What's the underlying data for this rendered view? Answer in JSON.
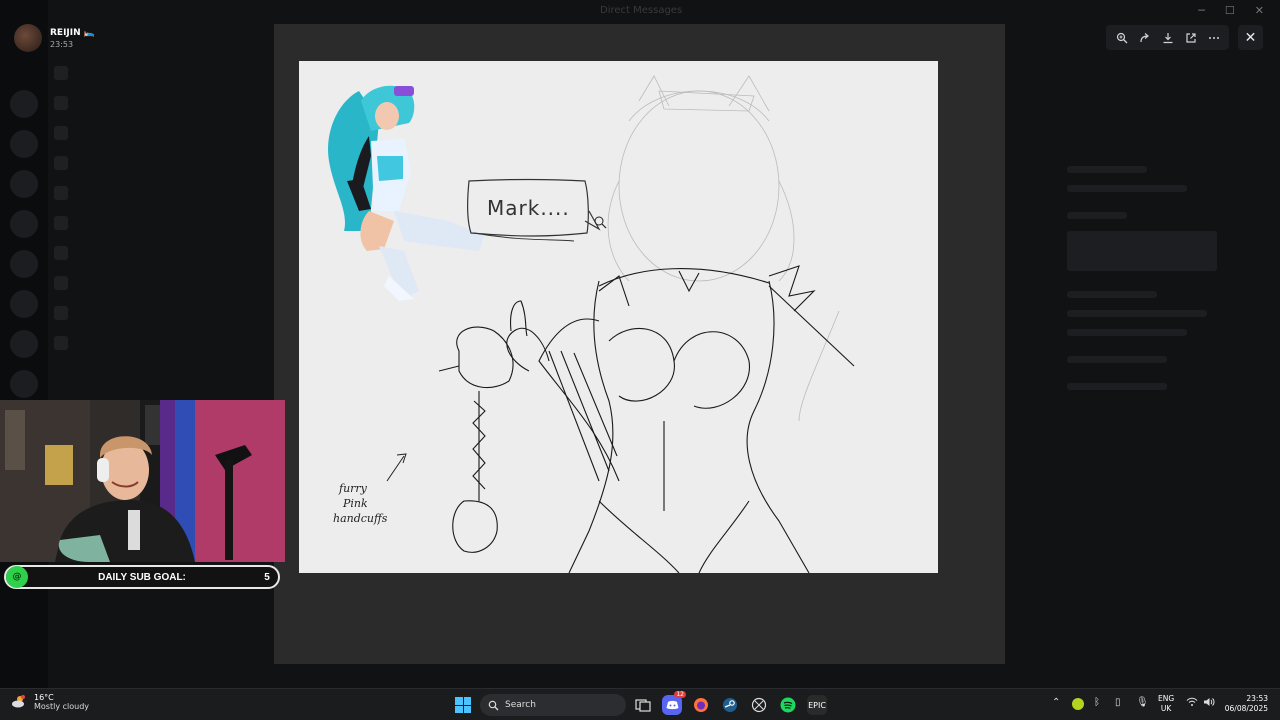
{
  "window": {
    "title": "Direct Messages"
  },
  "user": {
    "name": "REIJIN 🛌",
    "time": "23:53"
  },
  "drawing": {
    "bubble_text": "Mark....",
    "note_text": [
      "furry",
      "Pink",
      "handcuffs"
    ]
  },
  "viewer": {
    "tools": [
      "zoom-in-icon",
      "forward-icon",
      "download-icon",
      "open-external-icon",
      "more-icon"
    ],
    "close_label": "✕"
  },
  "stream": {
    "goal_label": "DAILY SUB GOAL:",
    "goal_value": "5",
    "goal_icon": "@"
  },
  "taskbar": {
    "weather_temp": "16°C",
    "weather_desc": "Mostly cloudy",
    "search_placeholder": "Search",
    "discord_badge": "12",
    "epic_label": "EPIC",
    "lang_line1": "ENG",
    "lang_line2": "UK",
    "clock_time": "23:53",
    "clock_date": "06/08/2025"
  },
  "colors": {
    "accent_green": "#2fd04a",
    "windows_blue": "#4cc2ff",
    "spotify": "#1ed760"
  }
}
